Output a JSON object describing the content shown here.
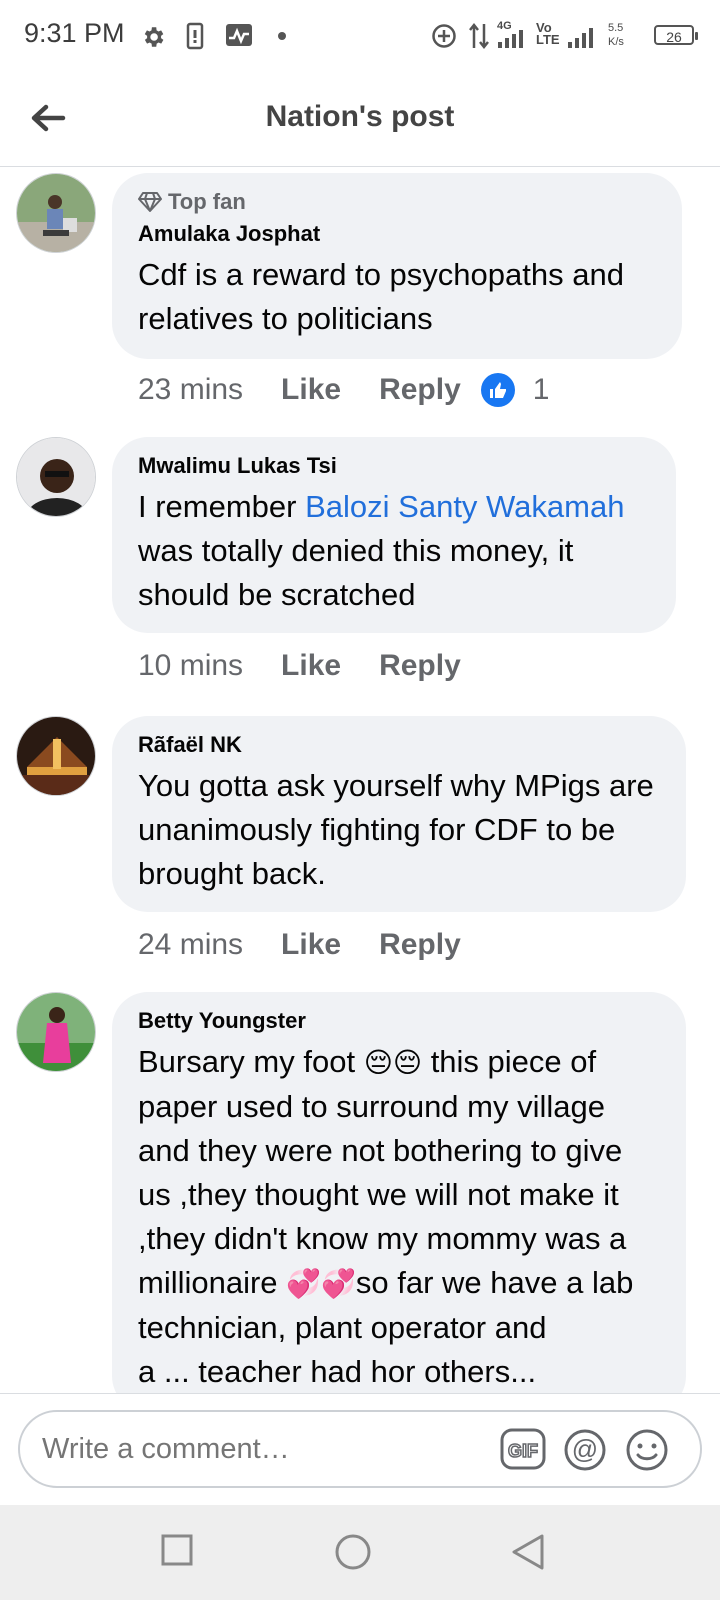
{
  "status_bar": {
    "time": "9:31 PM",
    "network_label": "4G",
    "volte_label": "Vo\nLTE",
    "speed_value": "5.5",
    "speed_unit": "K/s",
    "battery": "26",
    "icons": [
      "settings-icon",
      "sim-icon",
      "activity-icon",
      "dot-icon",
      "data-saver-icon",
      "data-arrows-icon",
      "signal-icon",
      "signal-icon",
      "battery-icon"
    ]
  },
  "header": {
    "title": "Nation's post",
    "back_icon": "arrow-left-icon"
  },
  "comments": [
    {
      "badge": "Top fan",
      "author": "Amulaka Josphat",
      "text": "Cdf is a reward to psychopaths and relatives to politicians",
      "time": "23 mins",
      "like": "Like",
      "reply": "Reply",
      "reaction_count": "1"
    },
    {
      "author": "Mwalimu Lukas Tsi",
      "text_before": "I remember ",
      "mention": "Balozi Santy Wakamah",
      "text_after": " was totally denied this money, it should be scratched",
      "time": "10 mins",
      "like": "Like",
      "reply": "Reply"
    },
    {
      "author": "Rãfaël NK",
      "text": "You gotta ask yourself why MPigs are unanimously fighting for CDF to be brought back.",
      "time": "24 mins",
      "like": "Like",
      "reply": "Reply"
    },
    {
      "author": "Betty Youngster",
      "text_1": "Bursary my foot ",
      "emoji_1": "😔😔",
      "text_2": " this piece of paper used to surround my village and they were not bothering to give us ,they thought we will not make it ,they didn't know my mommy was a millionaire ",
      "emoji_2": "💞💞",
      "text_3": "so far we have a lab technician, plant operator and",
      "text_cut": "a ... teacher had hor others..."
    }
  ],
  "composer": {
    "placeholder": "Write a comment…",
    "icons": [
      "gif-icon",
      "at-mention-icon",
      "emoji-icon"
    ]
  },
  "nav_bar": {
    "icons": [
      "recents-square-icon",
      "home-circle-icon",
      "back-triangle-icon"
    ]
  },
  "colors": {
    "accent": "#1877f2",
    "mention": "#216fdb",
    "bubble": "#f0f2f5",
    "secondary_text": "#65676b"
  }
}
